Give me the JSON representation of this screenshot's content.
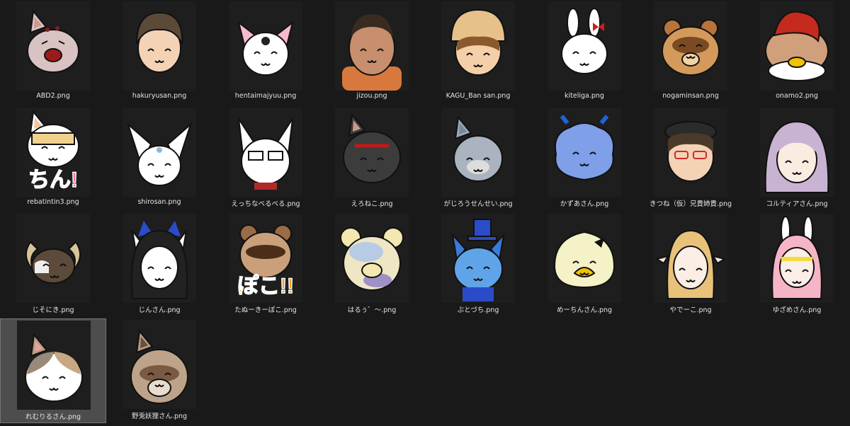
{
  "files": [
    {
      "name": "ABD2.png",
      "icon": "cat-face-red-mouth-icon"
    },
    {
      "name": "hakuryusan.png",
      "icon": "human-face-brown-hair-icon"
    },
    {
      "name": "hentaimajyuu.png",
      "icon": "white-fox-pink-ears-icon"
    },
    {
      "name": "jizou.png",
      "icon": "human-face-bald-icon"
    },
    {
      "name": "KAGU_Ban san.png",
      "icon": "human-face-cap-icon"
    },
    {
      "name": "kiteliga.png",
      "icon": "white-rabbit-bow-icon"
    },
    {
      "name": "nogaminsan.png",
      "icon": "tanuki-face-icon"
    },
    {
      "name": "onamo2.png",
      "icon": "bird-red-crest-icon"
    },
    {
      "name": "rebatintin3.png",
      "icon": "cat-glasses-sticker-icon"
    },
    {
      "name": "shirosan.png",
      "icon": "white-fennec-icon"
    },
    {
      "name": "えっちなべるべる.png",
      "icon": "white-fox-glasses-icon"
    },
    {
      "name": "えろねこ.png",
      "icon": "black-cat-red-glasses-icon"
    },
    {
      "name": "がじろうせんせい.png",
      "icon": "gray-wolf-icon"
    },
    {
      "name": "かずあさん.png",
      "icon": "blue-fluffy-creature-icon"
    },
    {
      "name": "きつね（仮）兄貴姉貴.png",
      "icon": "human-face-beret-icon"
    },
    {
      "name": "コルティアさん.png",
      "icon": "purple-hair-girl-icon"
    },
    {
      "name": "じそにき.png",
      "icon": "goat-horns-icon"
    },
    {
      "name": "じんさん.png",
      "icon": "black-hair-girl-ears-icon"
    },
    {
      "name": "たぬーきーぽこ.png",
      "icon": "raccoon-sticker-icon"
    },
    {
      "name": "はるぅ゛〜.png",
      "icon": "pastel-bear-icon"
    },
    {
      "name": "ぶとづち.png",
      "icon": "blue-wolf-top-hat-icon"
    },
    {
      "name": "めーちんさん.png",
      "icon": "yellow-duck-icon"
    },
    {
      "name": "やでーこ.png",
      "icon": "blonde-elf-icon"
    },
    {
      "name": "ゆざめさん.png",
      "icon": "pink-hair-bunny-icon"
    },
    {
      "name": "れむりるさん.png",
      "icon": "calico-cat-icon"
    },
    {
      "name": "野兎妖狸さん.png",
      "icon": "brown-raccoon-dog-icon"
    }
  ],
  "selected_index": 24,
  "colors": {
    "background": "#191919",
    "tile_dark": "#1e1e1e",
    "selected_bg": "#4d4d4d",
    "text": "#e6e6e6"
  }
}
